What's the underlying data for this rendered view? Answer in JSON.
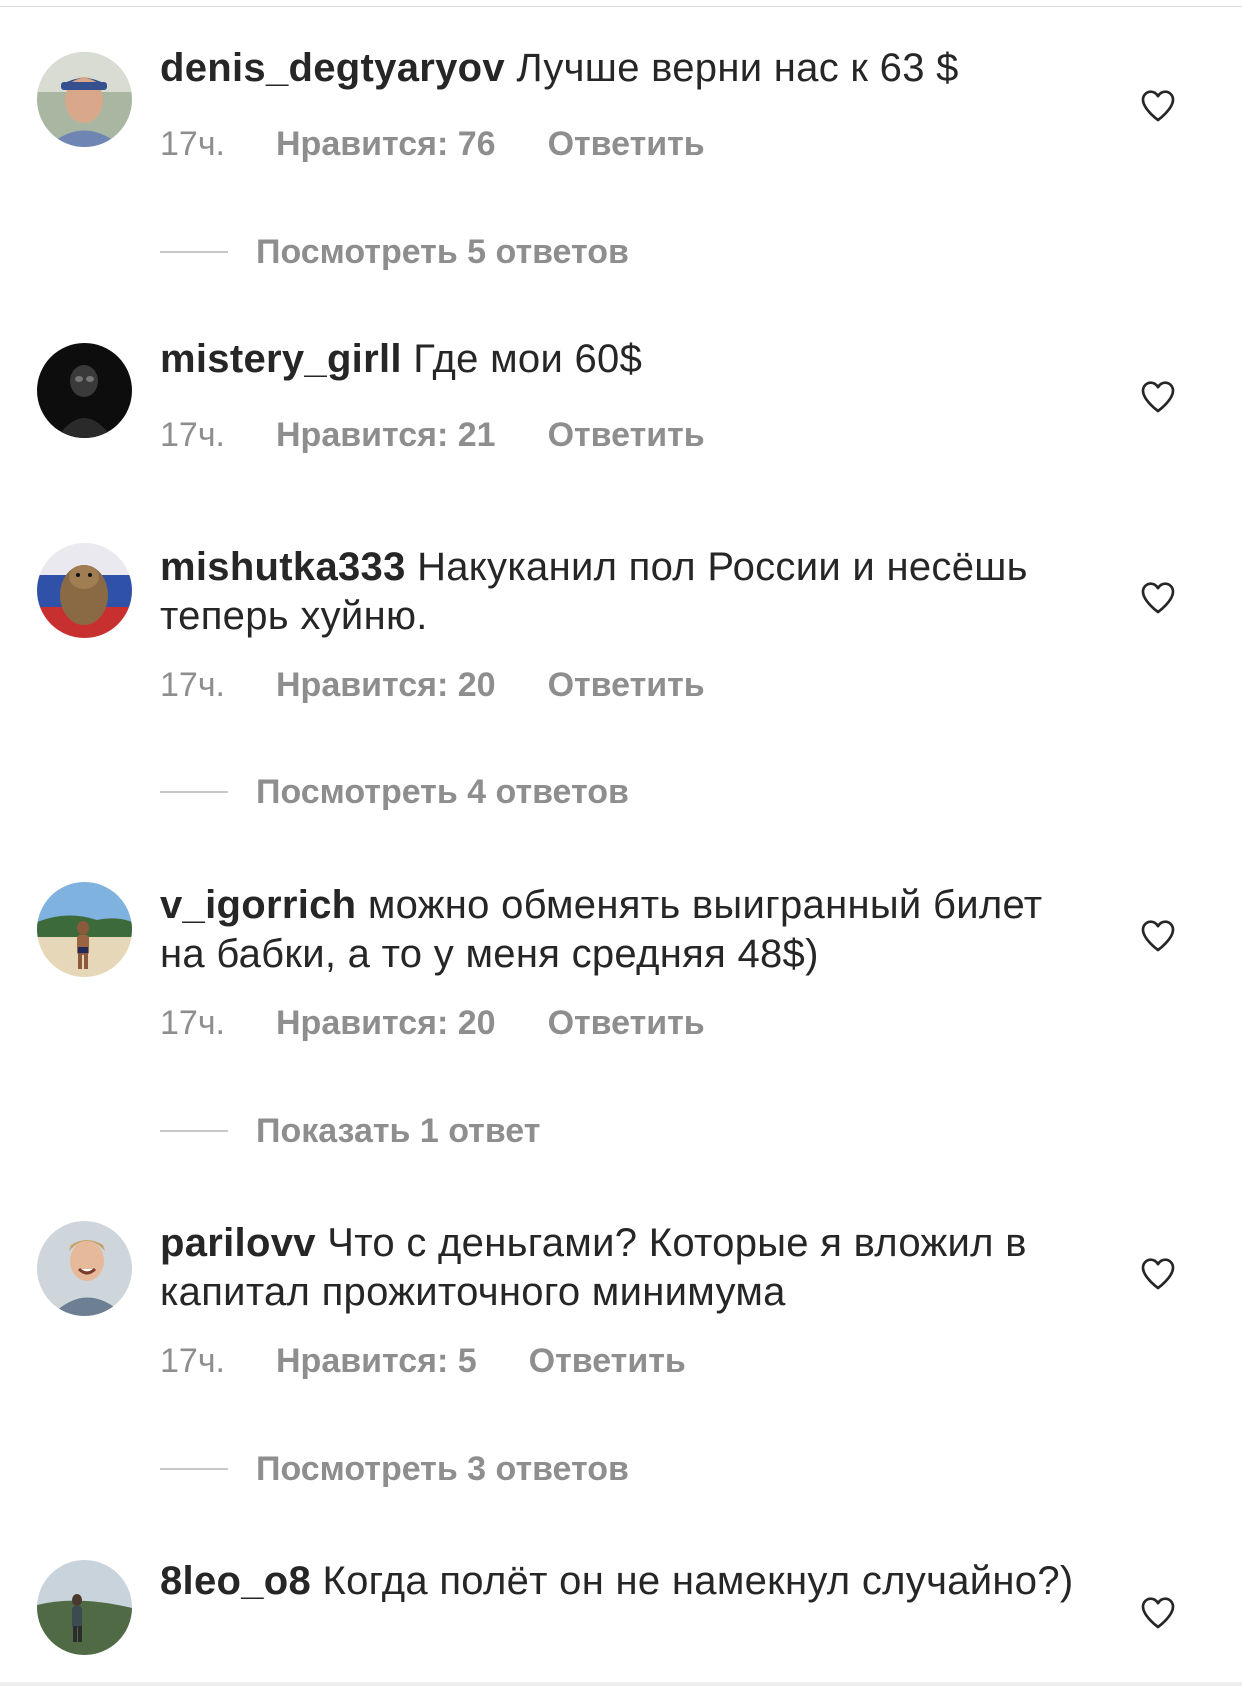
{
  "comments": [
    {
      "username": "denis_degtyaryov",
      "text": "Лучше верни нас к 63 $",
      "time": "17ч.",
      "likes": "Нравится: 76",
      "reply": "Ответить"
    },
    {
      "username": "mistery_girll",
      "text": "Где мои 60$",
      "time": "17ч.",
      "likes": "Нравится: 21",
      "reply": "Ответить"
    },
    {
      "username": "mishutka333",
      "text": "Накуканил пол России и несёшь теперь хуйню.",
      "time": "17ч.",
      "likes": "Нравится: 20",
      "reply": "Ответить"
    },
    {
      "username": "v_igorrich",
      "text": "можно обменять выигранный билет на бабки, а то у меня средняя 48$)",
      "time": "17ч.",
      "likes": "Нравится: 20",
      "reply": "Ответить"
    },
    {
      "username": "parilovv",
      "text": "Что с деньгами? Которые я вложил в капитал прожиточного минимума",
      "time": "17ч.",
      "likes": "Нравится: 5",
      "reply": "Ответить"
    },
    {
      "username": "8leo_o8",
      "text": "Когда полёт он не намекнул случайно?)"
    }
  ],
  "reply_threads": [
    {
      "label": "Посмотреть 5 ответов"
    },
    {
      "label": "Посмотреть 4 ответов"
    },
    {
      "label": "Показать 1 ответ"
    },
    {
      "label": "Посмотреть 3 ответов"
    }
  ],
  "icons": {
    "like": "heart-outline-icon",
    "avatar": "user-avatar"
  },
  "colors": {
    "text": "#262626",
    "secondary": "#8e8e8e",
    "divider": "#dbdbdb"
  }
}
